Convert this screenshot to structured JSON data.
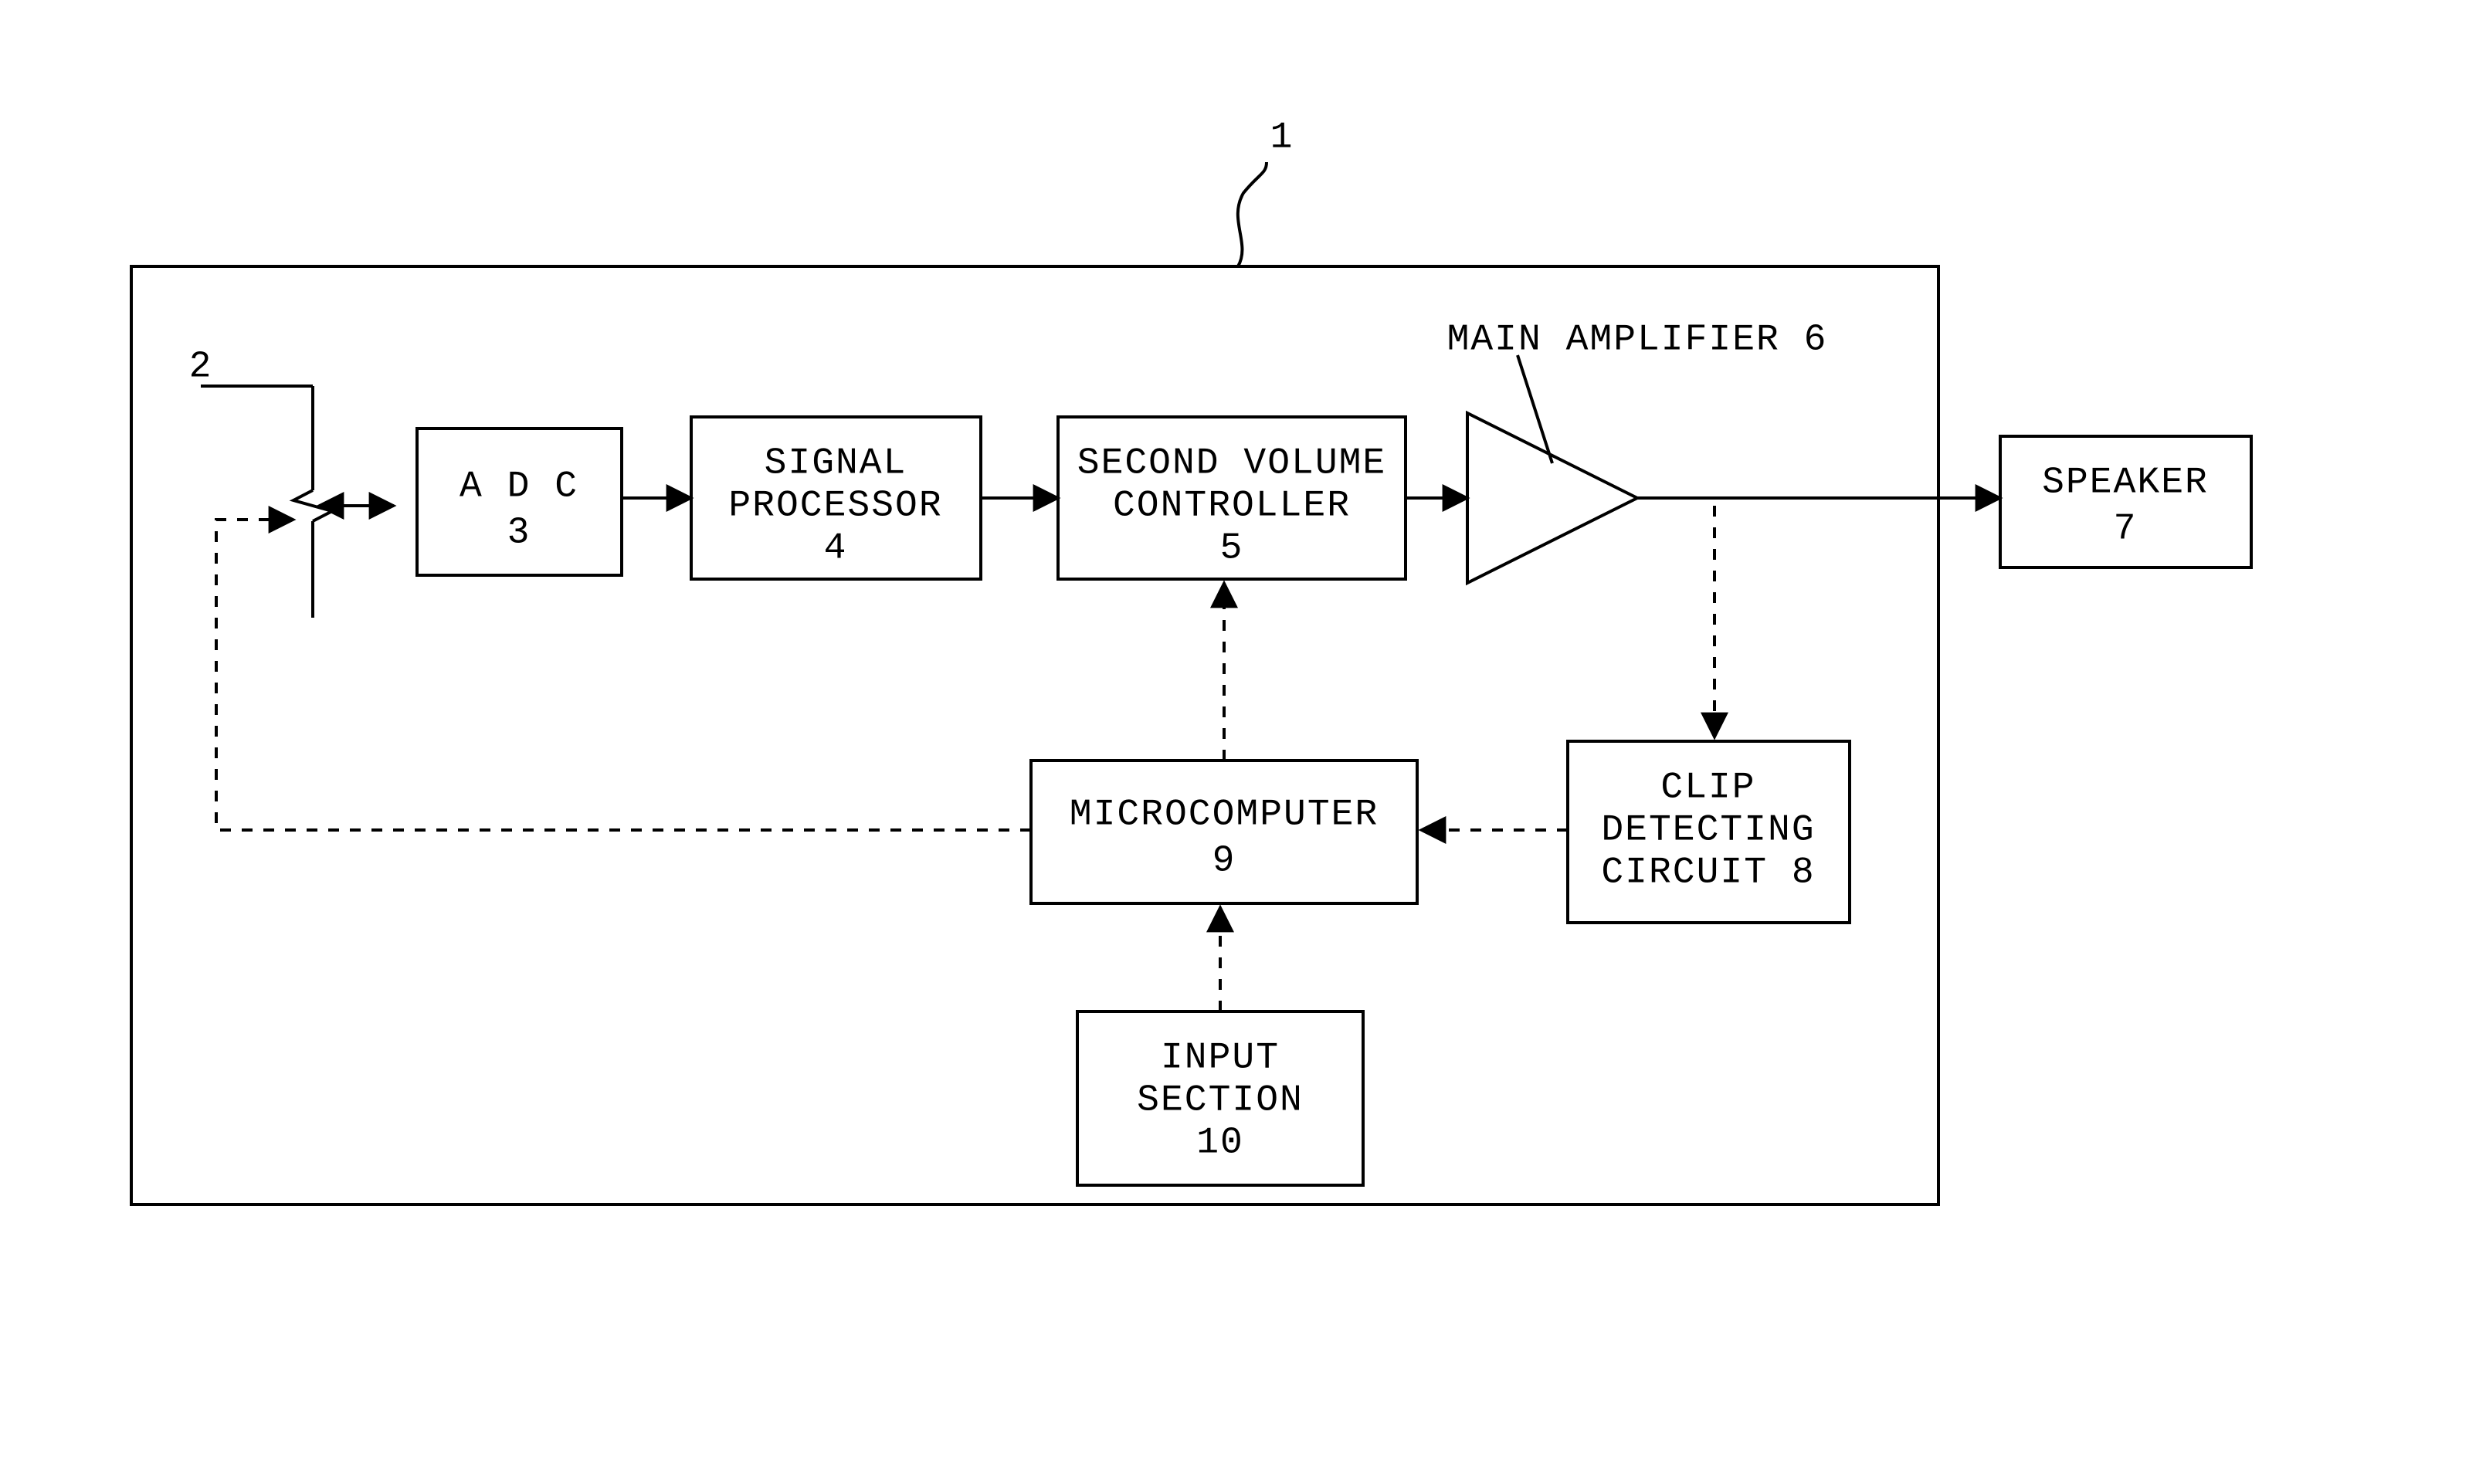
{
  "diagram": {
    "reference_num": "1",
    "first_volume_controller_num": "2",
    "adc": {
      "label": "A D C",
      "num": "3"
    },
    "signal_processor": {
      "label1": "SIGNAL",
      "label2": "PROCESSOR",
      "num": "4"
    },
    "second_volume_controller": {
      "label1": "SECOND VOLUME",
      "label2": "CONTROLLER",
      "num": "5"
    },
    "main_amplifier": {
      "label": "MAIN AMPLIFIER 6"
    },
    "speaker": {
      "label": "SPEAKER",
      "num": "7"
    },
    "clip_detecting": {
      "label1": "CLIP",
      "label2": "DETECTING",
      "label3": "CIRCUIT 8"
    },
    "microcomputer": {
      "label": "MICROCOMPUTER",
      "num": "9"
    },
    "input_section": {
      "label1": "INPUT",
      "label2": "SECTION",
      "num": "10"
    }
  }
}
